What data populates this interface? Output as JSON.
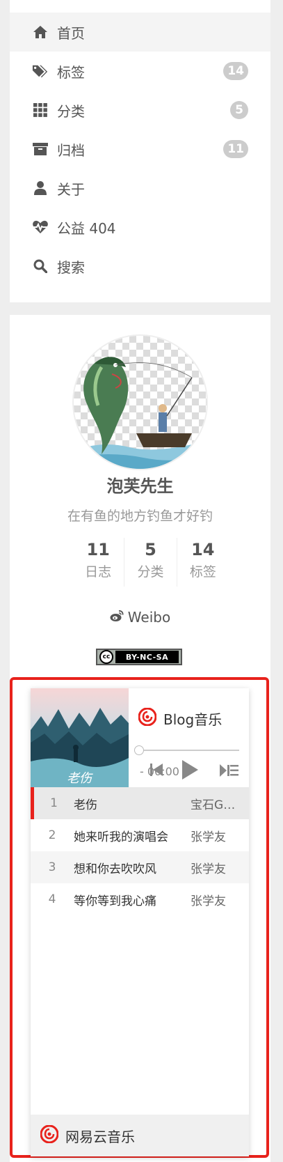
{
  "menu": {
    "items": [
      {
        "label": "首页",
        "icon": "home-icon"
      },
      {
        "label": "标签",
        "icon": "tags-icon",
        "badge": "14"
      },
      {
        "label": "分类",
        "icon": "grid-icon",
        "badge": "5"
      },
      {
        "label": "归档",
        "icon": "archive-icon",
        "badge": "11"
      },
      {
        "label": "关于",
        "icon": "user-icon"
      },
      {
        "label": "公益 404",
        "icon": "heartbeat-icon"
      },
      {
        "label": "搜索",
        "icon": "search-icon"
      }
    ]
  },
  "profile": {
    "name": "泡芙先生",
    "motto": "在有鱼的地方钓鱼才好钓",
    "stats": [
      {
        "num": "11",
        "label": "日志"
      },
      {
        "num": "5",
        "label": "分类"
      },
      {
        "num": "14",
        "label": "标签"
      }
    ],
    "weibo_label": "Weibo",
    "license": {
      "cc": "cc",
      "text": "BY-NC-SA"
    }
  },
  "player": {
    "title": "Blog音乐",
    "time": "- 00:00",
    "progress": 0,
    "tracks": [
      {
        "index": "1",
        "name": "老伤",
        "artist": "宝石Gem"
      },
      {
        "index": "2",
        "name": "她来听我的演唱会",
        "artist": "张学友"
      },
      {
        "index": "3",
        "name": "想和你去吹吹风",
        "artist": "张学友"
      },
      {
        "index": "4",
        "name": "等你等到我心痛",
        "artist": "张学友"
      }
    ],
    "cover_text": "老伤",
    "footer_label": "网易云音乐"
  },
  "colors": {
    "accent": "#e8221c",
    "badge": "#cccccc",
    "text": "#555555"
  }
}
